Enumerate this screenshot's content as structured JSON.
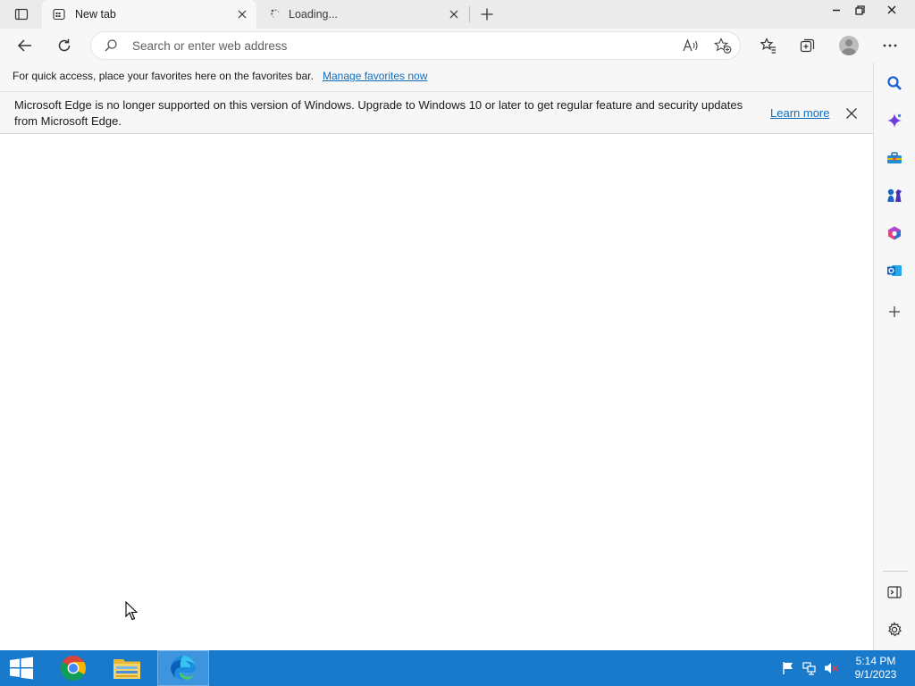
{
  "tabs": [
    {
      "title": "New tab",
      "active": true,
      "favicon": "new-tab-page-icon"
    },
    {
      "title": "Loading...",
      "active": false,
      "favicon": "loading-spinner-icon"
    }
  ],
  "address_bar": {
    "placeholder": "Search or enter web address",
    "value": ""
  },
  "favorites_bar": {
    "text": "For quick access, place your favorites here on the favorites bar.",
    "link": "Manage favorites now"
  },
  "info_bar": {
    "message": "Microsoft Edge is no longer supported on this version of Windows. Upgrade to Windows 10 or later to get regular feature and security updates from Microsoft Edge.",
    "link": "Learn more"
  },
  "sidebar": {
    "items": [
      "search-icon",
      "copilot-icon",
      "tools-icon",
      "games-icon",
      "office-icon",
      "outlook-icon",
      "add-icon"
    ],
    "bottom": [
      "hide-sidebar-icon",
      "settings-icon"
    ]
  },
  "taskbar": {
    "apps": [
      "start-icon",
      "chrome-icon",
      "file-explorer-icon",
      "edge-icon"
    ],
    "tray": [
      "action-center-flag-icon",
      "network-icon",
      "volume-muted-icon"
    ],
    "time": "5:14 PM",
    "date": "9/1/2023"
  },
  "colors": {
    "chrome_bg": "#ebebeb",
    "toolbar_bg": "#f7f7f7",
    "link": "#0f6cbd",
    "taskbar": "#1979ca"
  }
}
